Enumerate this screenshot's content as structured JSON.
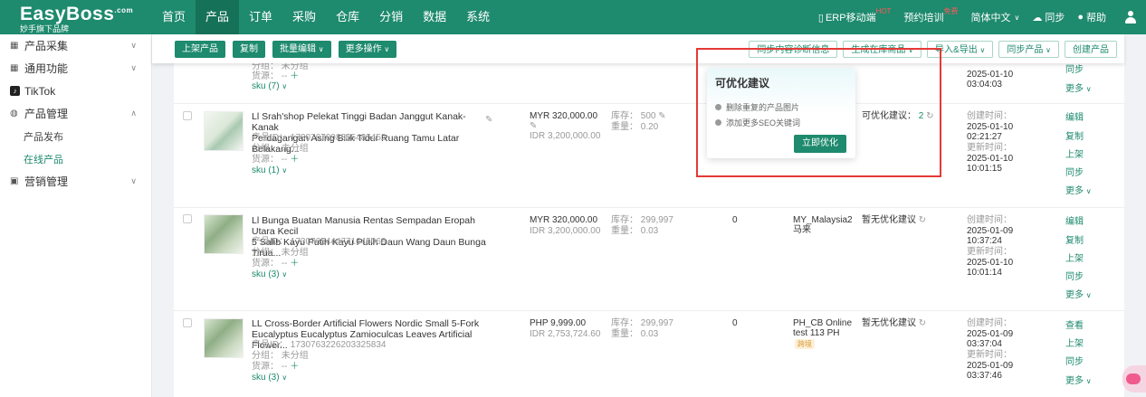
{
  "brand": {
    "logo": "EasyBoss",
    "logo_dot": ".com",
    "tagline": "妙手旗下品牌"
  },
  "nav": {
    "items": [
      "首页",
      "产品",
      "订单",
      "采购",
      "仓库",
      "分销",
      "数据",
      "系统"
    ],
    "active": "产品",
    "right": {
      "erp": "ERP移动端",
      "erp_badge": "HOT",
      "training": "预约培训",
      "training_badge": "免费",
      "language": "简体中文",
      "sync": "同步",
      "help": "帮助"
    }
  },
  "sidebar": {
    "groups": [
      {
        "label": "产品采集",
        "icon": "grid-icon",
        "expanded": false
      },
      {
        "label": "通用功能",
        "icon": "grid-icon",
        "expanded": false
      },
      {
        "label": "TikTok",
        "icon": "tiktok-icon"
      },
      {
        "label": "产品管理",
        "icon": "box-icon",
        "expanded": true,
        "children": [
          {
            "label": "产品发布",
            "active": false
          },
          {
            "label": "在线产品",
            "active": true
          }
        ]
      },
      {
        "label": "营销管理",
        "icon": "megaphone-icon",
        "expanded": false
      }
    ]
  },
  "toolbar": {
    "left": [
      "上架产品",
      "复制",
      "批量编辑",
      "更多操作"
    ],
    "right": [
      "同步内容诊断信息",
      "生成在库商品",
      "导入&导出",
      "同步产品",
      "创建产品"
    ]
  },
  "popup": {
    "title": "可优化建议",
    "items": [
      "删除重复的产品图片",
      "添加更多SEO关键词"
    ],
    "button": "立即优化"
  },
  "partial_row": {
    "group": "分组：  未分组",
    "source": "货源：  --",
    "sku": "sku (7)",
    "time1": "2025-01-10",
    "time2": "03:04:03",
    "action1": "同步",
    "action2": "更多"
  },
  "rows": [
    {
      "title1": "Ll Srah'shop Pelekat Tinggi Badan Janggut Kanak-Kanak",
      "title2": "Perdagangan Asing Bilik Tidur Ruang Tamu Latar Belakang...",
      "product_id": "产品ID：  1730767098865485452",
      "group": "分组：  未分组",
      "source": "货源：  --",
      "sku": "sku (1)",
      "price": "MYR 320,000.00",
      "price_alt": "IDR 3,200,000.00",
      "stock": "库存：  500",
      "weight": "重量：  0.20",
      "sales": "",
      "shop": "",
      "shop2": "",
      "suggest_label": "可优化建议：",
      "suggest_count": "2",
      "created_label": "创建时间：",
      "created_date": "2025-01-10",
      "created_time": "02:21:27",
      "updated_label": "更新时间：",
      "updated_date": "2025-01-10",
      "updated_time": "10:01:15",
      "actions": [
        "编辑",
        "复制",
        "上架",
        "同步",
        "更多"
      ]
    },
    {
      "title1": "Ll Bunga Buatan Manusia Rentas Sempadan Eropah Utara Kecil",
      "title2": "5 Salib Kayu Putih Kayu Putih Daun Wang Daun Bunga Tirua...",
      "product_id": "产品ID：  1730765444771645068",
      "group": "分组：  未分组",
      "source": "货源：  --",
      "sku": "sku (3)",
      "price": "MYR 320,000.00",
      "price_alt": "IDR 3,200,000.00",
      "stock": "库存：  299,997",
      "weight": "重量：  0.03",
      "sales": "0",
      "shop": "MY_Malaysia2",
      "shop2": "马来",
      "suggest_label": "暂无优化建议",
      "suggest_count": "",
      "created_label": "创建时间：",
      "created_date": "2025-01-09",
      "created_time": "10:37:24",
      "updated_label": "更新时间：",
      "updated_date": "2025-01-10",
      "updated_time": "10:01:14",
      "actions": [
        "编辑",
        "复制",
        "上架",
        "同步",
        "更多"
      ]
    },
    {
      "title1": "LL Cross-Border Artificial Flowers Nordic Small 5-Fork",
      "title2": "Eucalyptus Eucalyptus Zamioculcas Leaves Artificial Flower...",
      "product_id": "产品ID：  1730763226203325834",
      "group": "分组：  未分组",
      "source": "货源：  --",
      "sku": "sku (3)",
      "price": "PHP 9,999.00",
      "price_alt": "IDR 2,753,724.60",
      "stock": "库存：  299,997",
      "weight": "重量：  0.03",
      "sales": "0",
      "shop": "PH_CB Online",
      "shop2": "test 113 PH",
      "shop_tag": "跨境",
      "suggest_label": "暂无优化建议",
      "suggest_count": "",
      "created_label": "创建时间：",
      "created_date": "2025-01-09",
      "created_time": "03:37:04",
      "updated_label": "更新时间：",
      "updated_date": "2025-01-09",
      "updated_time": "03:37:46",
      "actions": [
        "查看",
        "上架",
        "同步",
        "更多"
      ]
    }
  ],
  "colors": {
    "brand_green": "#1e8a6e",
    "highlight_red": "#e53935"
  }
}
